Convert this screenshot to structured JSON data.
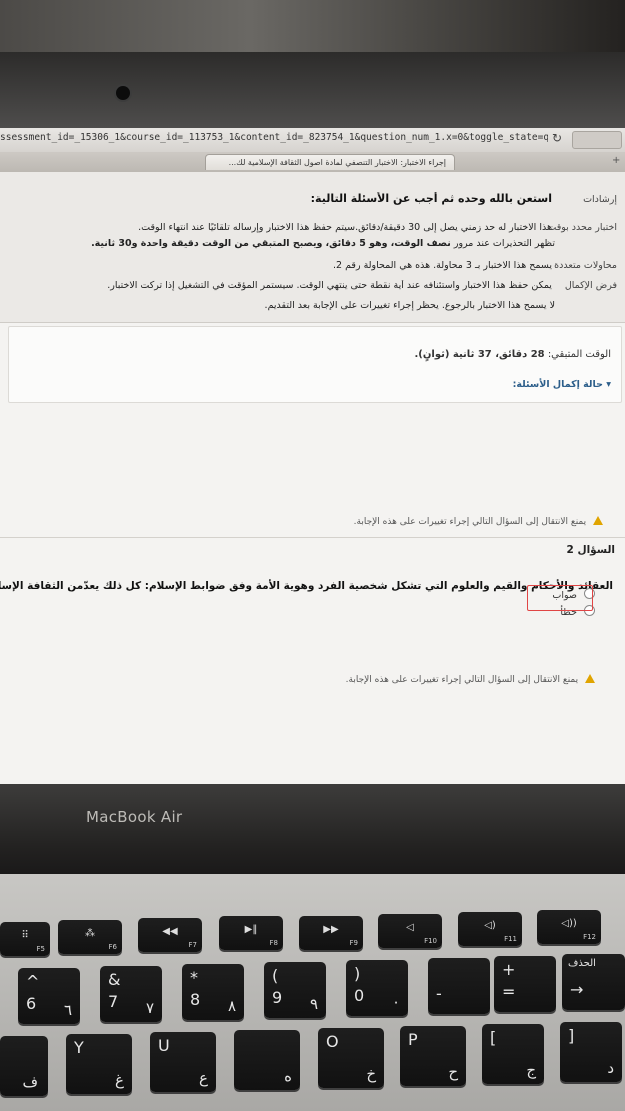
{
  "browser": {
    "url": "ssessment_id=_15306_1&course_id=_113753_1&content_id=_823754_1&question_num_1.x=0&toggle_state=qShow&step=null",
    "tab_title": "إجراء الاختبار: الاختبار التنصفي لمادة اصول الثقافة الإسلامية لك..."
  },
  "instructions": {
    "label": "إرشادات",
    "heading": "استعن بالله وحده ثم أجب عن الأسئلة التالية:",
    "timed_label": "اختبار محدد بوقت",
    "timed_text": "هذا الاختبار له حد زمني يصل إلى 30 دقيقة/دقائق.سيتم حفظ هذا الاختبار وإرساله تلقائيًا عند انتهاء الوقت.",
    "warnings_text_1": "تظهر التحذيرات عند مرور",
    "warnings_bold_1": "نصف الوقت،",
    "warnings_text_2": "وهو 5 دقائق،",
    "warnings_bold_2": "ويصبح المتبقي من الوقت دقيقة واحدة و30 ثانية.",
    "attempts_label": "محاولات متعددة",
    "attempts_text": "يسمح هذا الاختبار بـ 3 محاولة. هذه هي المحاولة رقم 2.",
    "force_label": "فرض الإكمال",
    "force_text": "يمكن حفظ هذا الاختبار واستئنافه عند أية نقطة حتى ينتهي الوقت. سيستمر المؤقت في التشغيل إذا تركت الاختبار.",
    "backtrack_text": "لا يسمح هذا الاختبار بالرجوع. يحظر إجراء تغييرات على الإجابة بعد التقديم."
  },
  "timer": {
    "label": "الوقت المتبقي:",
    "value": "28 دقائق، 37 ثانية (ثوانٍ)."
  },
  "completion_status": "حالة إكمال الأسئلة:",
  "notice": "يمنع الانتقال إلى السؤال التالي إجراء تغييرات على هذه الإجابة.",
  "question": {
    "title": "السؤال 2",
    "text": "العقائد والأحكام والقيم والعلوم التي تشكل شخصية الفرد وهوية الأمة وفق ضوابط الإسلام: كل ذلك يعدّمن الثقافة الإسلامية.",
    "options": [
      "صواب",
      "خطأ"
    ]
  },
  "laptop": {
    "brand": "MacBook Air"
  },
  "keys": {
    "f5": "F5",
    "f6": "F6",
    "f7": "F7",
    "f8": "F8",
    "f9": "F9",
    "f10": "F10",
    "f11": "F11",
    "f12": "F12",
    "delete_ar": "الحذف",
    "six": "6",
    "six_ar": "٦",
    "seven": "7",
    "seven_sym": "&",
    "seven_ar": "٧",
    "eight": "8",
    "eight_sym": "*",
    "eight_ar": "٨",
    "nine": "9",
    "nine_sym": "(",
    "nine_ar": "٩",
    "zero": "0",
    "zero_sym": ")",
    "zero_ar": "٠",
    "minus": "-",
    "equals_sym": "+",
    "equals": "=",
    "y_lat": "Y",
    "y_ar": "غ",
    "u_lat": "U",
    "u_ar": "ع",
    "o_lat": "O",
    "o_ar": "خ",
    "p_lat": "P",
    "p_ar": "ح",
    "br_l": "[",
    "br_l_ar": "ج",
    "br_r": "]",
    "br_r_ar": "د",
    "f_ar": "ف",
    "i_ar": "ه",
    "arrow": "→"
  }
}
